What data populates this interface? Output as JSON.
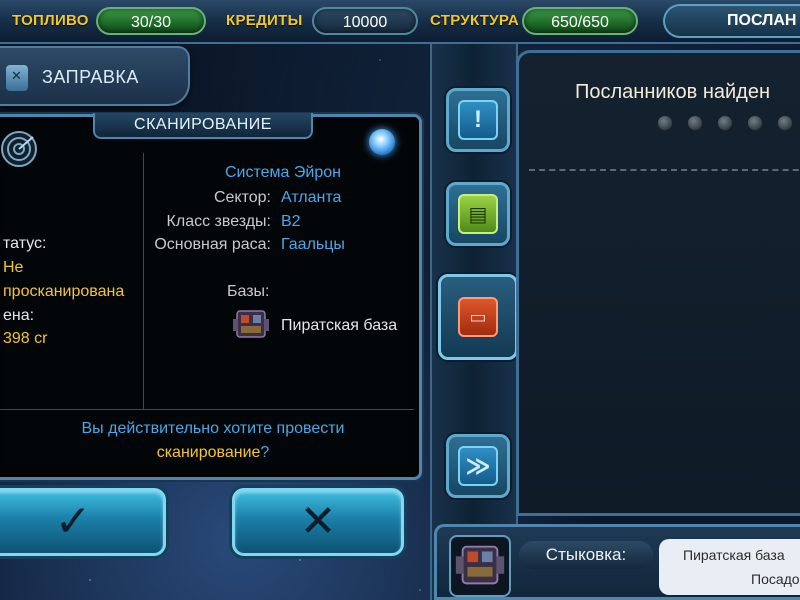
{
  "topbar": {
    "fuel_label": "ТОПЛИВО",
    "fuel_value": "30/30",
    "credits_label": "КРЕДИТЫ",
    "credits_value": "10000",
    "structure_label": "СТРУКТУРА",
    "structure_value": "650/650",
    "tab_label": "ПОСЛАН"
  },
  "refuel": {
    "label": "ЗАПРАВКА"
  },
  "scan_panel": {
    "title": "СКАНИРОВАНИЕ",
    "status_label": "татус:",
    "status_value_1": "Не",
    "status_value_2": "просканирована",
    "price_label": "ена:",
    "price_value": "398 cr",
    "system_name": "Система Эйрон",
    "details": [
      {
        "key": "Сектор:",
        "value": "Атланта"
      },
      {
        "key": "Класс звезды:",
        "value": "B2"
      },
      {
        "key": "Основная раса:",
        "value": "Гаальцы"
      }
    ],
    "bases_label": "Базы:",
    "base_name": "Пиратская база",
    "confirm_line1": "Вы действительно хотите провести",
    "confirm_line2": "сканирование",
    "confirm_qmark": "?"
  },
  "buttons": {
    "ok_glyph": "✓",
    "cancel_glyph": "✕"
  },
  "nav": [
    {
      "name": "alert",
      "glyph": "!"
    },
    {
      "name": "notes",
      "glyph": "▤"
    },
    {
      "name": "messages",
      "glyph": "▭"
    },
    {
      "name": "forward",
      "glyph": "≫"
    }
  ],
  "right_panel": {
    "title": "Посланников найден",
    "dots_count": 5
  },
  "dock": {
    "label": "Стыковка:",
    "value_line1": "Пиратская база",
    "value_line2": "Посадо"
  },
  "colors": {
    "accent_yellow": "#f5c62a",
    "accent_blue": "#4aa8e8",
    "panel_border": "#4f86ad",
    "button_cyan": "#3fbde0"
  }
}
